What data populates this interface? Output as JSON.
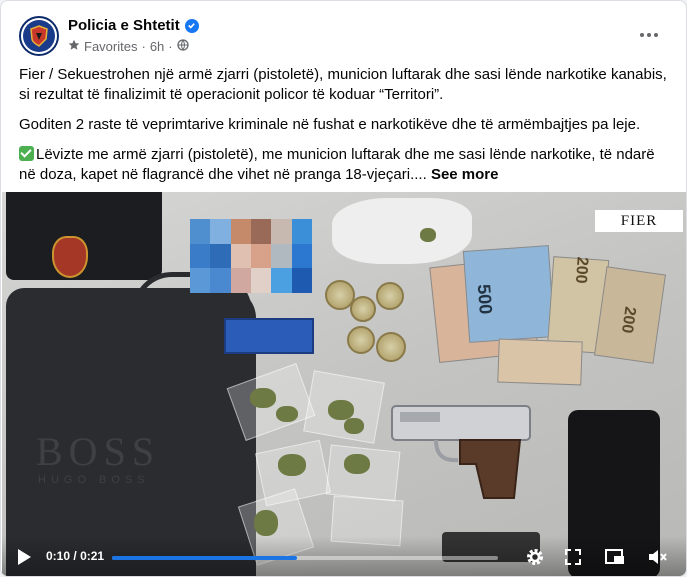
{
  "page": {
    "name": "Policia e Shtetit",
    "meta_favorites": "Favorites",
    "meta_separator": "·",
    "meta_time": "6h",
    "meta_separator2": "·"
  },
  "post": {
    "paragraph_1": "Fier / Sekuestrohen një armë zjarri (pistoletë), municion luftarak dhe sasi lënde narkotike kanabis, si rezultat të finalizimit të operacionit policor të koduar “Territori”.",
    "paragraph_2": "Goditen 2 raste të veprimtarive kriminale në fushat e narkotikëve dhe të armëmbajtjes pa leje.",
    "paragraph_3": "Lëvizte me armë zjarri (pistoletë), me municion luftarak dhe me sasi lënde narkotike, të ndarë në doza, kapet në flagrancë dhe vihet në pranga 18-vjeçari....",
    "see_more": "See more"
  },
  "video": {
    "watermark_location": "FIER",
    "bag_brand": "BOSS",
    "bag_brand_sub": "HUGO BOSS",
    "money_label_1": "200",
    "money_label_2": "200",
    "money_label_3": "500",
    "time_current": "0:10",
    "time_separator": "/",
    "time_total": "0:21",
    "progress_fraction": 0.48
  },
  "icons": {
    "verified": "verified-badge-icon",
    "favorites": "star-icon",
    "privacy": "globe-icon",
    "more": "more-options-icon",
    "play": "play-icon",
    "settings": "settings-gear-icon",
    "fullscreen": "fullscreen-icon",
    "pip": "picture-in-picture-icon",
    "volume": "volume-muted-icon"
  },
  "colors": {
    "accent": "#1877f2",
    "progress": "#1b74e4",
    "text": "#050505",
    "meta": "#65676b",
    "check": "#4caf50"
  }
}
